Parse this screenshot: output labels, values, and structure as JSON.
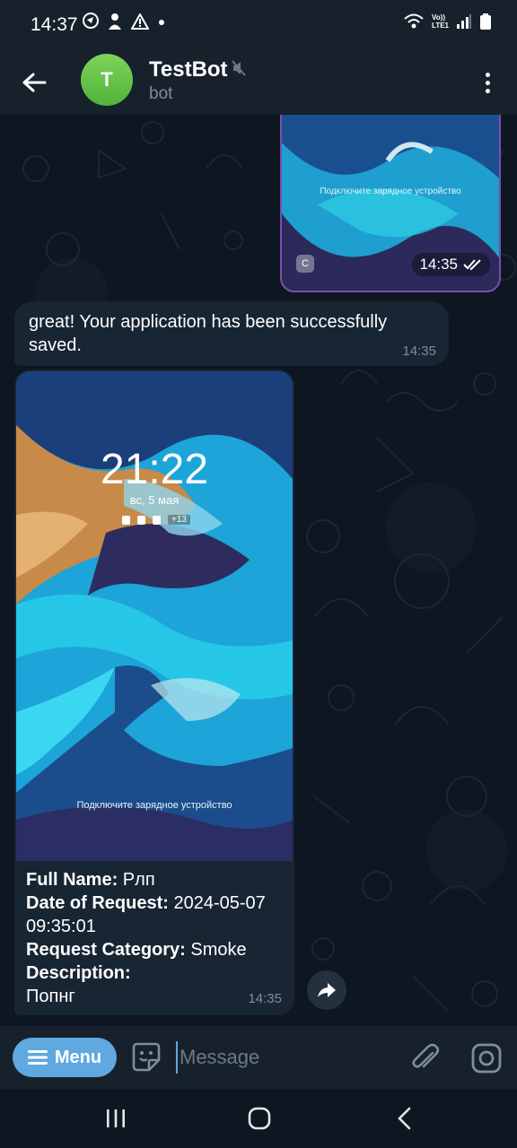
{
  "status_bar": {
    "time": "14:37",
    "network_label": "LTE1",
    "volte_label": "Vo))"
  },
  "header": {
    "avatar_letter": "T",
    "title": "TestBot",
    "subtitle": "bot"
  },
  "messages": {
    "outgoing_image": {
      "lock_text": "Подключите зарядное устройство",
      "badge": "C",
      "time": "14:35",
      "status": "read"
    },
    "bot_text": {
      "text": "great! Your application has been successfully saved.",
      "time": "14:35"
    },
    "bot_image": {
      "clock": "21:22",
      "date": "вс, 5 мая",
      "notif_count": "+13",
      "lock_text": "Подключите зарядное устройство",
      "caption": [
        {
          "label": "Full Name:",
          "value": " Рлп"
        },
        {
          "label": "Date of Request:",
          "value": " 2024-05-07 09:35:01"
        },
        {
          "label": "Request Category:",
          "value": " Smoke"
        },
        {
          "label": "Description:",
          "value": ""
        },
        {
          "label": "",
          "value": "Попнг"
        }
      ],
      "time": "14:35"
    }
  },
  "composer": {
    "menu_label": "Menu",
    "placeholder": "Message"
  },
  "colors": {
    "accent": "#5fa8e0",
    "header_bg": "#17212b",
    "chat_bg": "#0e1621",
    "bubble_bg": "#182533",
    "avatar": "#5cbb3e"
  },
  "icons": [
    "back-arrow-icon",
    "mute-icon",
    "more-vert-icon",
    "share-icon",
    "sticker-icon",
    "paperclip-icon",
    "camera-icon",
    "double-check-icon"
  ]
}
